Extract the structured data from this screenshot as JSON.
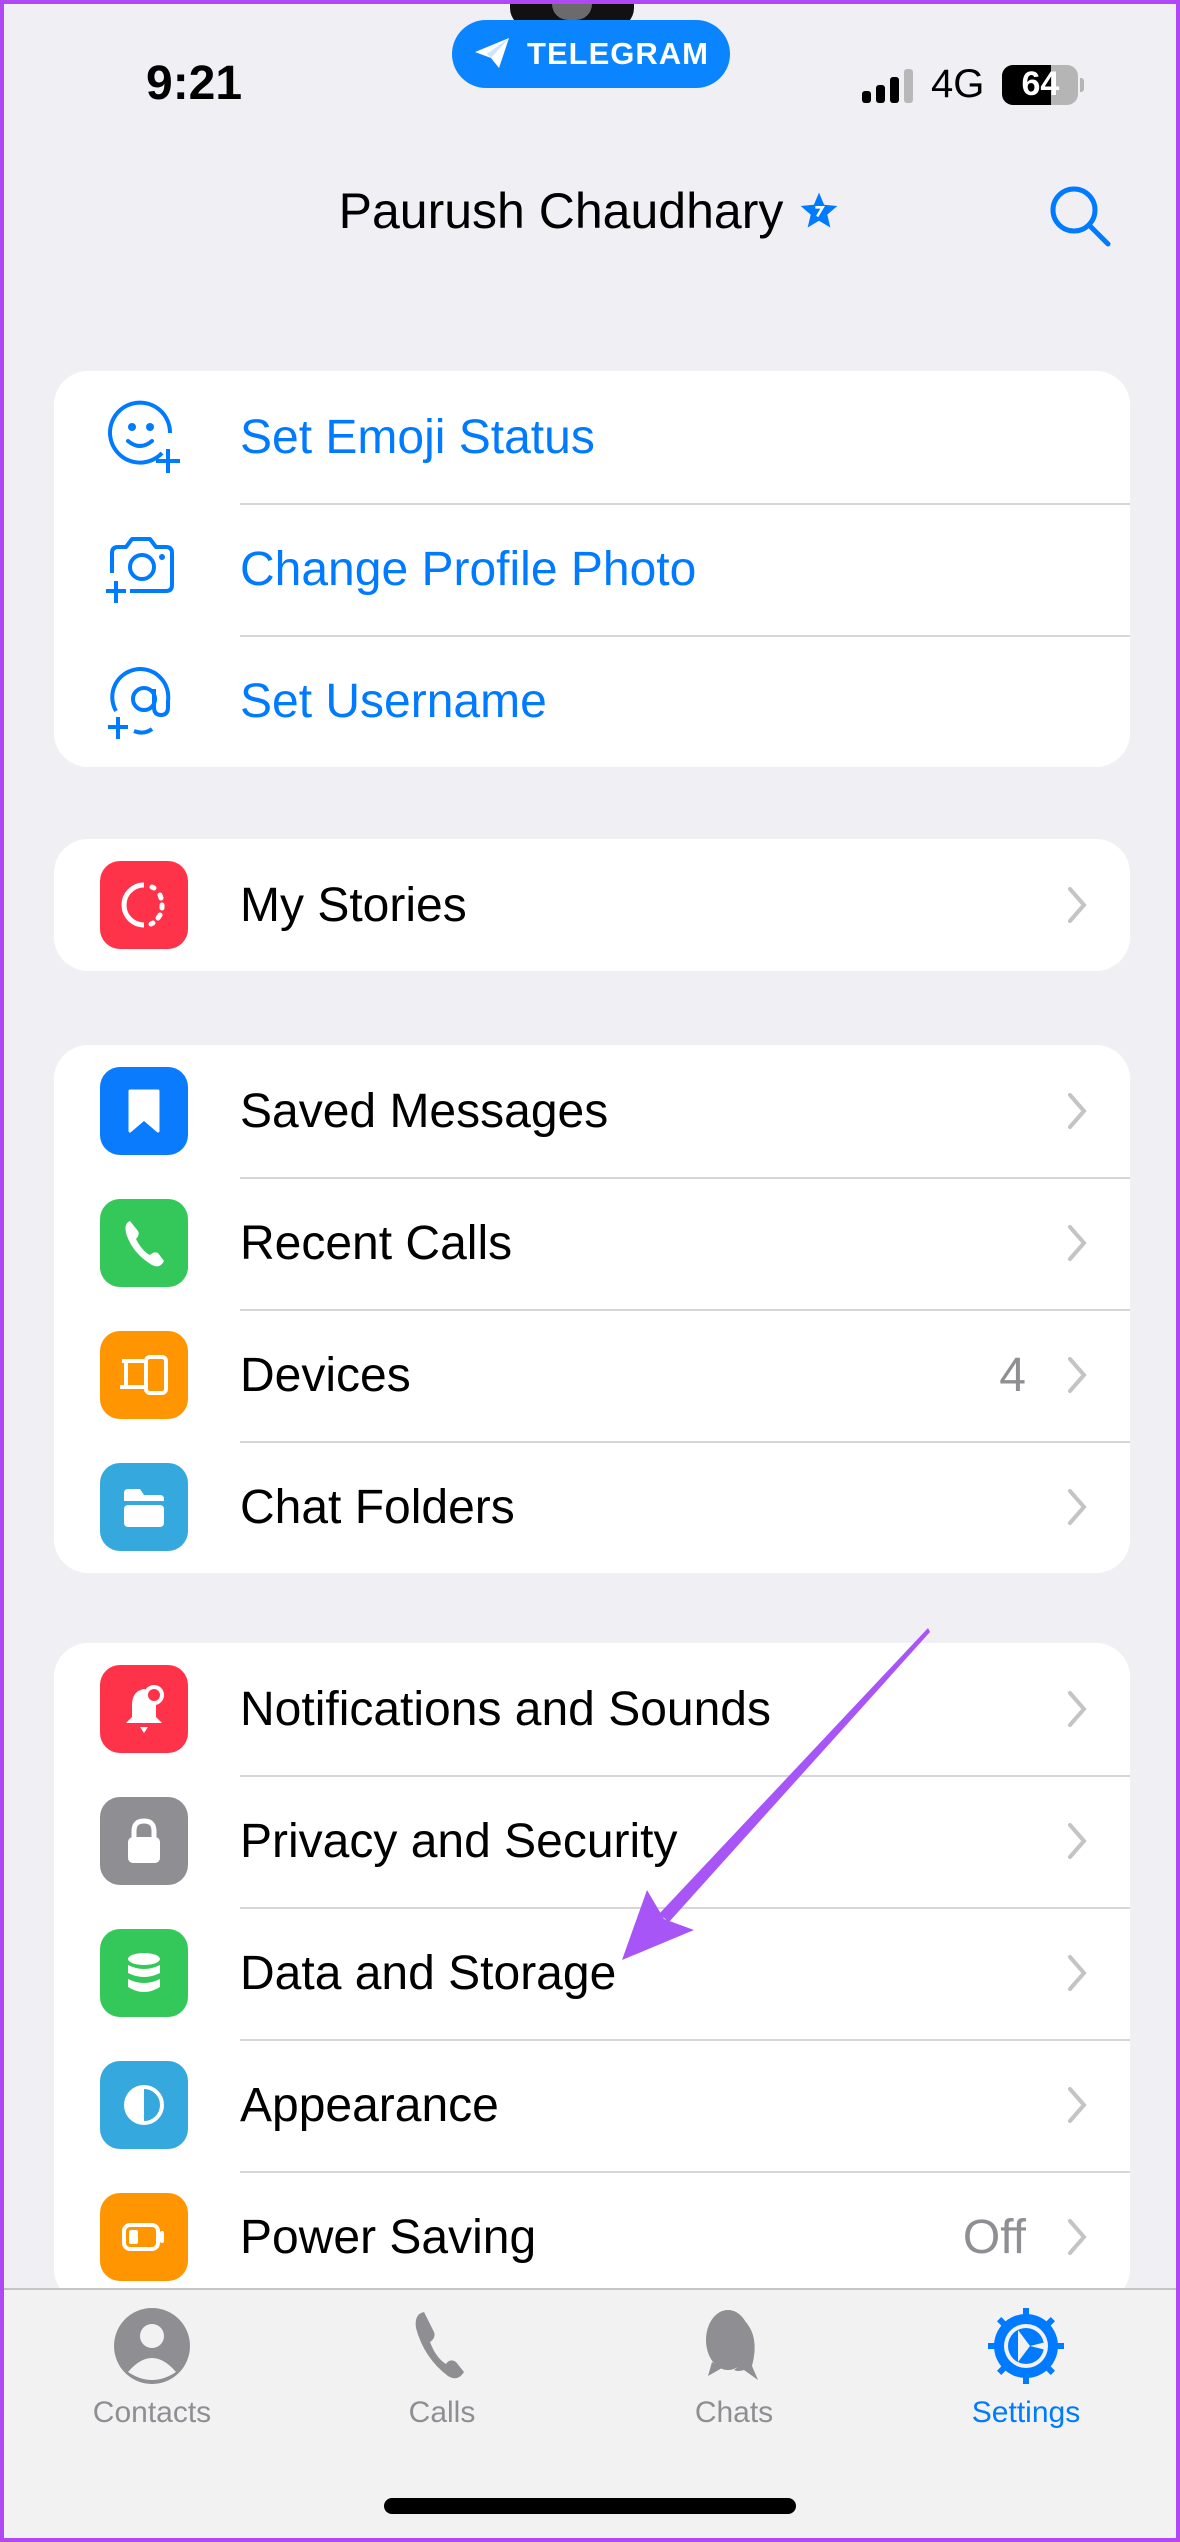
{
  "status_bar": {
    "time": "9:21",
    "app_pill_label": "TELEGRAM",
    "network": "4G",
    "battery_percent": 64,
    "battery_label": "64",
    "signal_bars_active": 3,
    "signal_bars_total": 4
  },
  "header": {
    "title": "Paurush Chaudhary",
    "premium_badge": "star-icon",
    "search_icon": "search-icon"
  },
  "profile_actions": [
    {
      "label": "Set Emoji Status",
      "icon": "emoji-status-icon"
    },
    {
      "label": "Change Profile Photo",
      "icon": "camera-add-icon"
    },
    {
      "label": "Set Username",
      "icon": "at-add-icon"
    }
  ],
  "stories_section": [
    {
      "label": "My Stories",
      "icon": "stories-icon",
      "color": "#fe3349"
    }
  ],
  "main_section": [
    {
      "label": "Saved Messages",
      "icon": "bookmark-icon",
      "color": "#0a7bfd"
    },
    {
      "label": "Recent Calls",
      "icon": "phone-icon",
      "color": "#34c759"
    },
    {
      "label": "Devices",
      "icon": "devices-icon",
      "color": "#ff9500",
      "value": "4"
    },
    {
      "label": "Chat Folders",
      "icon": "folder-icon",
      "color": "#35a8dd"
    }
  ],
  "settings_section": [
    {
      "label": "Notifications and Sounds",
      "icon": "bell-icon",
      "color": "#fe3349"
    },
    {
      "label": "Privacy and Security",
      "icon": "lock-icon",
      "color": "#8e8e93"
    },
    {
      "label": "Data and Storage",
      "icon": "database-icon",
      "color": "#34c759"
    },
    {
      "label": "Appearance",
      "icon": "appearance-icon",
      "color": "#35a8dd"
    },
    {
      "label": "Power Saving",
      "icon": "battery-icon",
      "color": "#ff9500",
      "value": "Off"
    }
  ],
  "tab_bar": {
    "tabs": [
      {
        "label": "Contacts",
        "icon": "contacts-icon",
        "active": false
      },
      {
        "label": "Calls",
        "icon": "calls-icon",
        "active": false
      },
      {
        "label": "Chats",
        "icon": "chats-icon",
        "active": false
      },
      {
        "label": "Settings",
        "icon": "settings-icon",
        "active": true
      }
    ]
  },
  "colors": {
    "accent": "#007aff",
    "annotation_arrow": "#a855f7",
    "background": "#efeff4",
    "frame_border": "#b048f5"
  },
  "annotation": {
    "type": "arrow",
    "points_to": "Data and Storage"
  }
}
